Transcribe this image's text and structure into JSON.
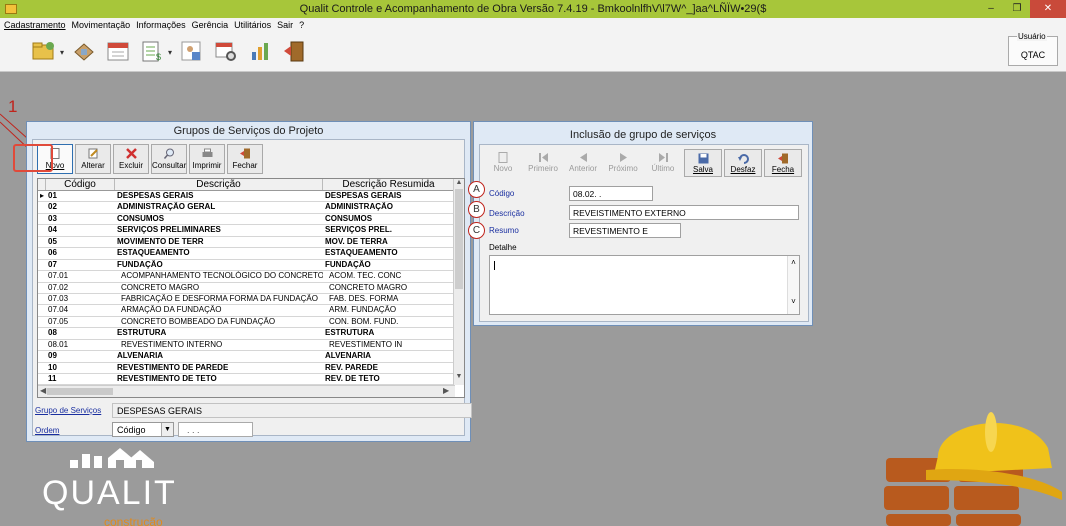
{
  "window": {
    "title": "Qualit Controle e Acompanhamento de Obra Versão 7.4.19 - BmkoolnlfhV\\l7W^_]aa^LÑÏW•29($",
    "controls": [
      "–",
      "❐",
      "✕"
    ]
  },
  "menu": [
    "Cadastramento",
    "Movimentação",
    "Informações",
    "Gerência",
    "Utilitários",
    "Sair",
    "?"
  ],
  "toolbar_icons": [
    "folder-icon",
    "tools-icon",
    "calendar-icon",
    "spreadsheet-icon",
    "chart-person-icon",
    "calendar-clock-icon",
    "stats-icon",
    "exit-door-icon"
  ],
  "usuario": {
    "label": "Usuário",
    "value": "QTAC"
  },
  "annotation_number": "1",
  "left_window": {
    "title": "Grupos de Serviços do Projeto",
    "buttons": [
      "Novo",
      "Alterar",
      "Excluir",
      "Consultar",
      "Imprimir",
      "Fechar"
    ],
    "columns": [
      "Código",
      "Descrição",
      "Descrição Resumida"
    ],
    "rows": [
      {
        "code": "01",
        "desc": "DESPESAS GERAIS",
        "short": "DESPESAS GERAIS",
        "bold": true,
        "current": true
      },
      {
        "code": "02",
        "desc": "ADMINISTRAÇÃO GERAL",
        "short": "ADMINISTRAÇÃO",
        "bold": true
      },
      {
        "code": "03",
        "desc": "CONSUMOS",
        "short": "CONSUMOS",
        "bold": true
      },
      {
        "code": "04",
        "desc": "SERVIÇOS PRELIMINARES",
        "short": "SERVIÇOS PREL.",
        "bold": true
      },
      {
        "code": "05",
        "desc": "MOVIMENTO DE TERR",
        "short": "MOV. DE TERRA",
        "bold": true
      },
      {
        "code": "06",
        "desc": "ESTAQUEAMENTO",
        "short": "ESTAQUEAMENTO",
        "bold": true
      },
      {
        "code": "07",
        "desc": "FUNDAÇÃO",
        "short": "FUNDAÇÃO",
        "bold": true
      },
      {
        "code": "07.01",
        "desc": "ACOMPANHAMENTO TECNOLÓGICO DO CONCRETO",
        "short": "ACOM. TEC. CONC",
        "bold": false
      },
      {
        "code": "07.02",
        "desc": "CONCRETO MAGRO",
        "short": "CONCRETO MAGRO",
        "bold": false
      },
      {
        "code": "07.03",
        "desc": "FABRICAÇÃO E DESFORMA FORMA DA FUNDAÇÃO",
        "short": "FAB. DES. FORMA",
        "bold": false
      },
      {
        "code": "07.04",
        "desc": "ARMAÇÃO DA FUNDAÇÃO",
        "short": "ARM. FUNDAÇÃO",
        "bold": false
      },
      {
        "code": "07.05",
        "desc": "CONCRETO BOMBEADO DA FUNDAÇÃO",
        "short": "CON. BOM. FUND.",
        "bold": false
      },
      {
        "code": "08",
        "desc": "ESTRUTURA",
        "short": "ESTRUTURA",
        "bold": true
      },
      {
        "code": "08.01",
        "desc": "REVESTIMENTO INTERNO",
        "short": "REVESTIMENTO IN",
        "bold": false
      },
      {
        "code": "09",
        "desc": "ALVENARIA",
        "short": "ALVENARIA",
        "bold": true
      },
      {
        "code": "10",
        "desc": "REVESTIMENTO DE PAREDE",
        "short": "REV. PAREDE",
        "bold": true
      },
      {
        "code": "11",
        "desc": "REVESTIMENTO DE TETO",
        "short": "REV. DE TETO",
        "bold": true
      }
    ],
    "grupo_label": "Grupo de Serviços",
    "grupo_value": "DESPESAS GERAIS",
    "ordem_label": "Ordem",
    "ordem_value": "Código",
    "ordem_search": ". . ."
  },
  "right_window": {
    "title": "Inclusão de grupo de serviços",
    "buttons": [
      {
        "label": "Novo",
        "enabled": false
      },
      {
        "label": "Primeiro",
        "enabled": false
      },
      {
        "label": "Anterior",
        "enabled": false
      },
      {
        "label": "Próximo",
        "enabled": false
      },
      {
        "label": "Último",
        "enabled": false
      },
      {
        "label": "Salva",
        "enabled": true
      },
      {
        "label": "Desfaz",
        "enabled": true
      },
      {
        "label": "Fecha",
        "enabled": true
      }
    ],
    "codigo_label": "Código",
    "codigo_value": "08.02. .",
    "descricao_label": "Descrição",
    "descricao_value": "REVEISTIMENTO EXTERNO",
    "resumo_label": "Resumo",
    "resumo_value": "REVESTIMENTO E",
    "detalhe_label": "Detalhe",
    "markers": [
      "A",
      "B",
      "C"
    ]
  },
  "brand": {
    "logo_text": "QUALIT",
    "logo_sub": "construção"
  },
  "colors": {
    "titlebar": "#a7c63a",
    "desktop": "#9b9b9b",
    "window_frame": "#dfe9f5",
    "annotation": "#c0241c",
    "link_label": "#1a2fa0",
    "logo_orange": "#e08a1e"
  }
}
